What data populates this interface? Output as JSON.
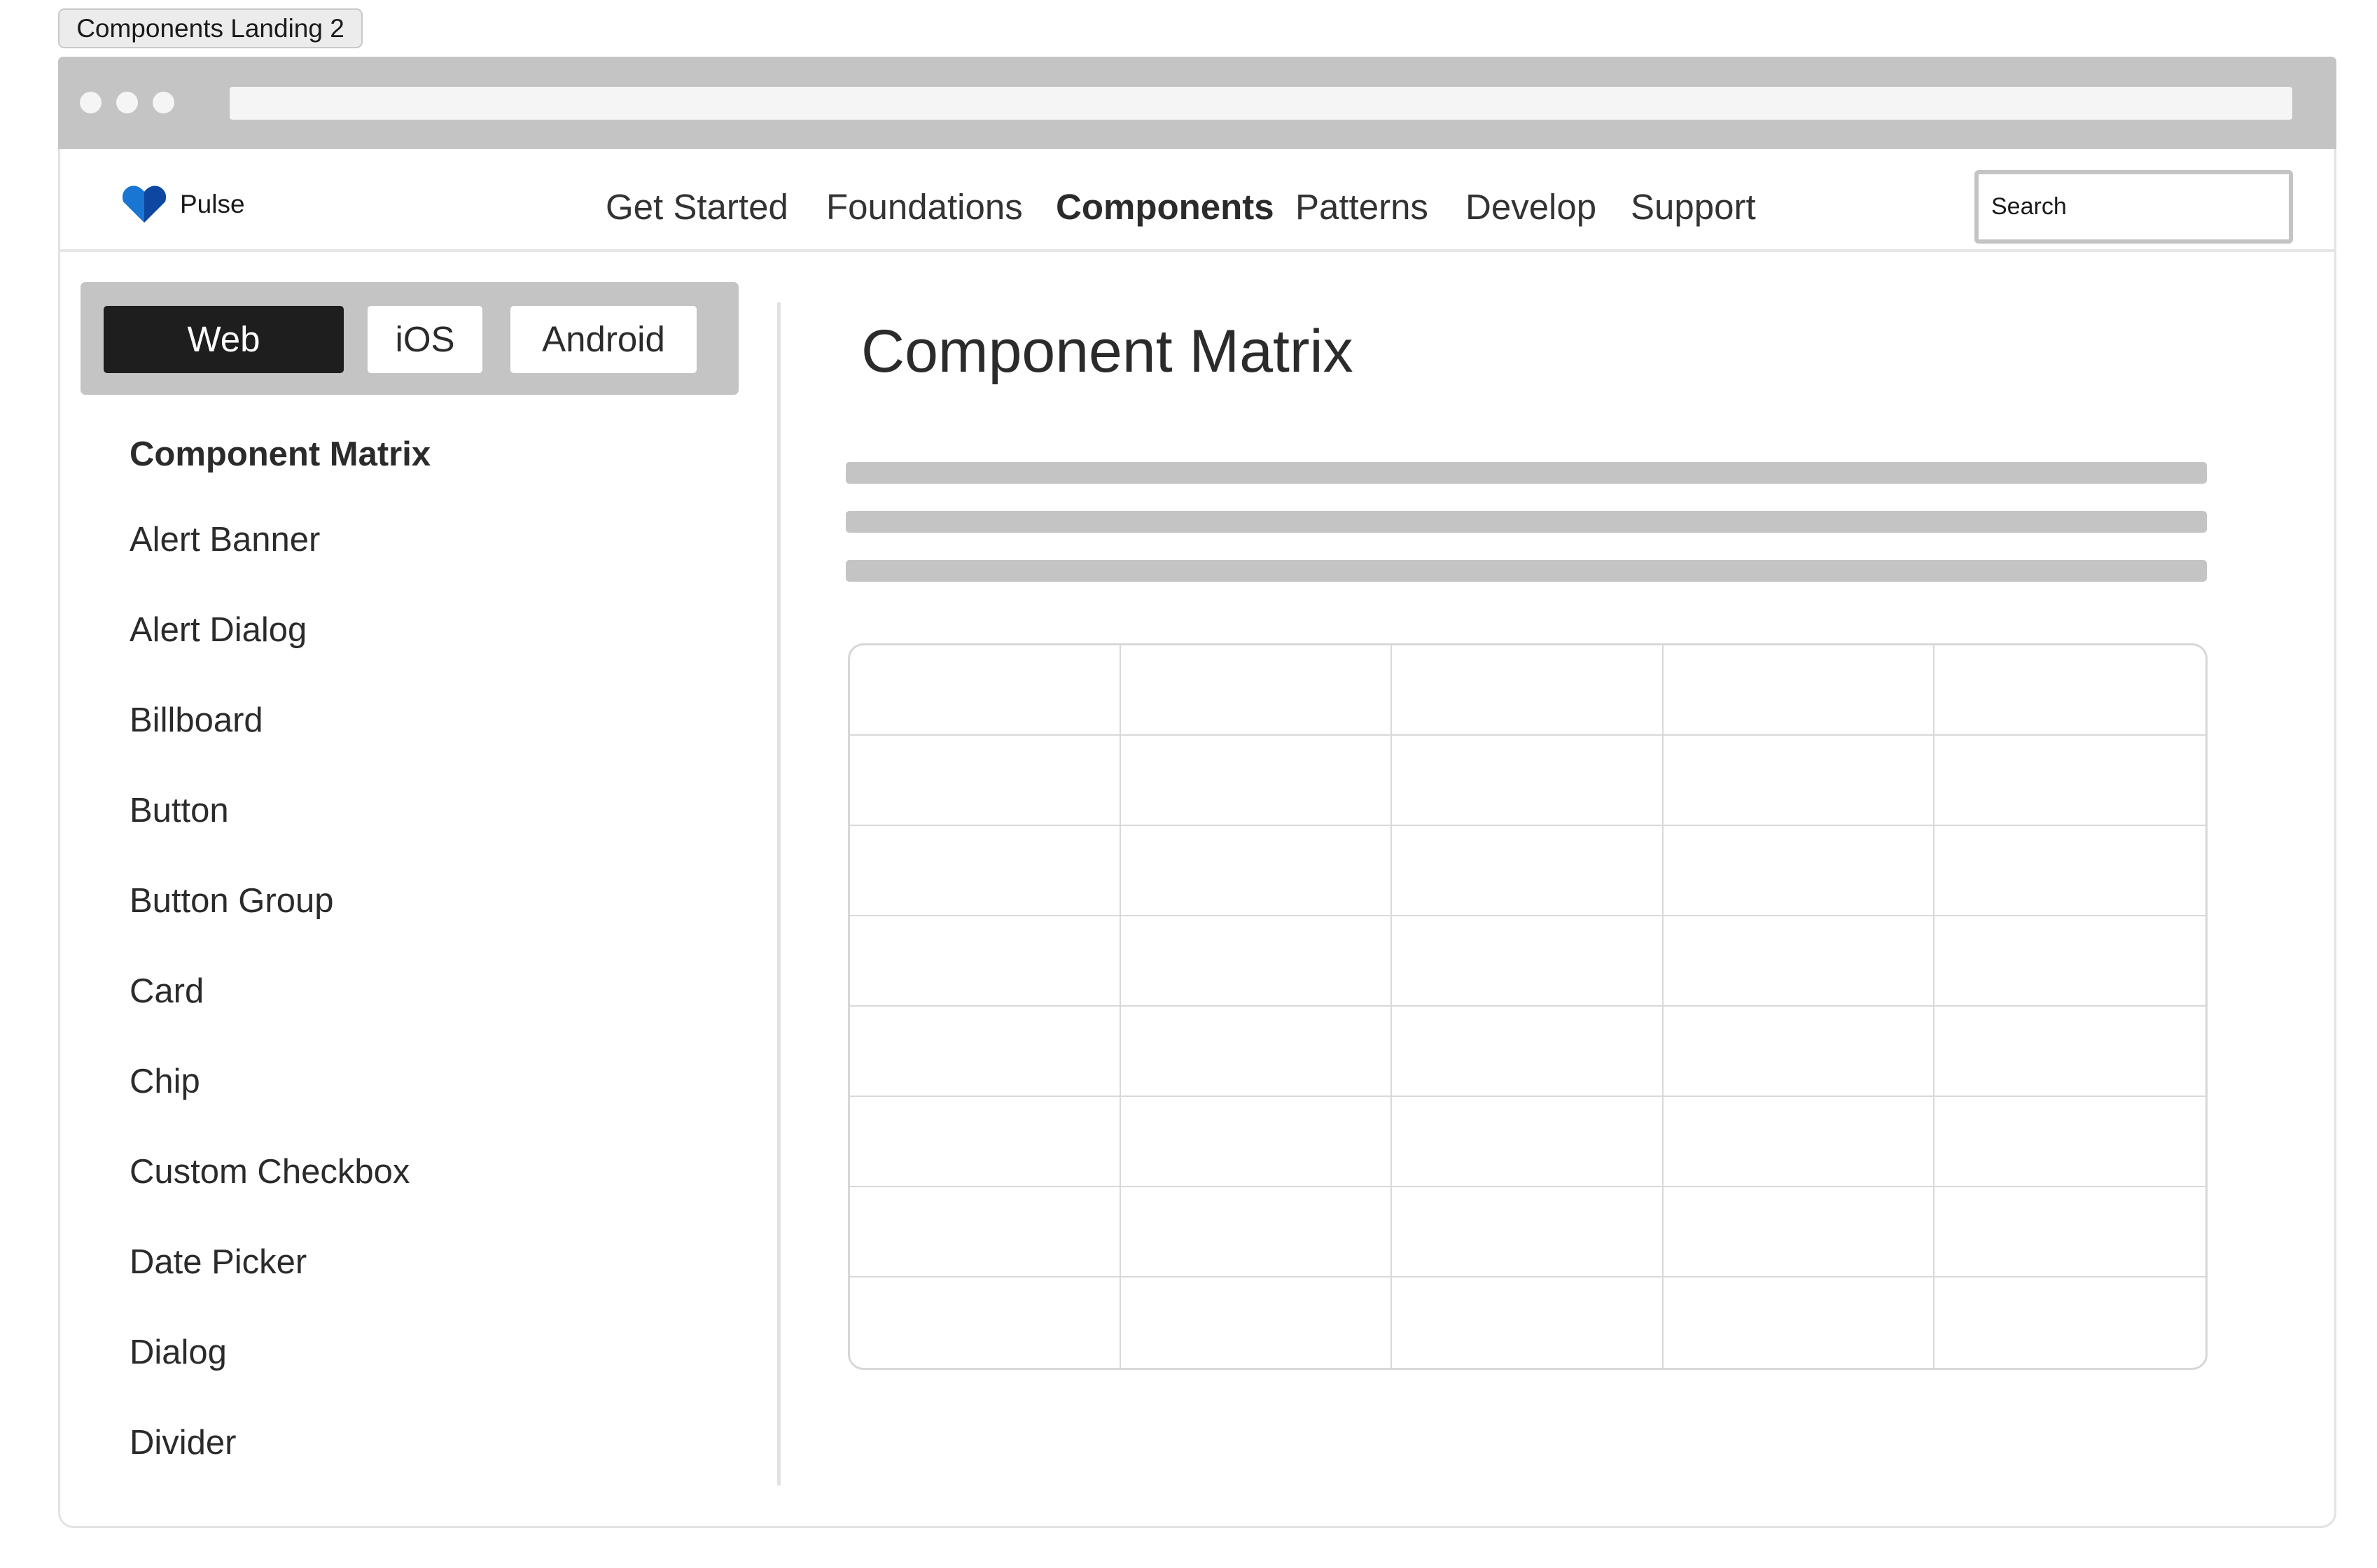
{
  "frame_label": "Components Landing 2",
  "brand": {
    "name": "Pulse",
    "logo_icon": "heart-logo-icon",
    "logo_color": "#1565C0"
  },
  "nav": {
    "items": [
      "Get Started",
      "Foundations",
      "Components",
      "Patterns",
      "Develop",
      "Support"
    ],
    "active": "Components"
  },
  "search": {
    "placeholder": "Search"
  },
  "platform_switcher": {
    "options": [
      "Web",
      "iOS",
      "Android"
    ],
    "selected": "Web"
  },
  "sidebar": {
    "items": [
      "Component Matrix",
      "Alert Banner",
      "Alert Dialog",
      "Billboard",
      "Button",
      "Button Group",
      "Card",
      "Chip",
      "Custom Checkbox",
      "Date Picker",
      "Dialog",
      "Divider"
    ],
    "active": "Component Matrix"
  },
  "main": {
    "title": "Component Matrix",
    "text_placeholder_lines": 3,
    "matrix": {
      "rows": 8,
      "columns": 5
    }
  }
}
